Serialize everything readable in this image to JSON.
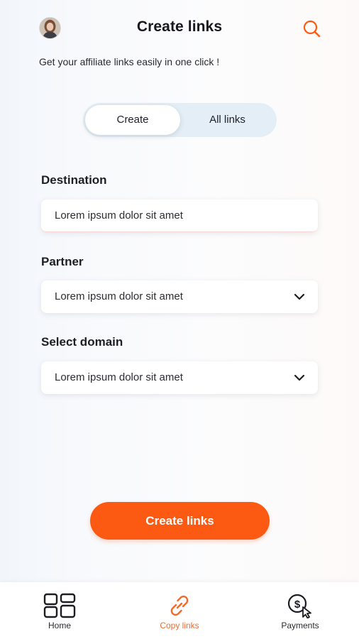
{
  "header": {
    "title": "Create links",
    "subtitle": "Get your affiliate links easily in one click !"
  },
  "tabs": [
    {
      "label": "Create",
      "active": true
    },
    {
      "label": "All links",
      "active": false
    }
  ],
  "form": {
    "destination": {
      "label": "Destination",
      "value": "Lorem ipsum dolor sit amet"
    },
    "partner": {
      "label": "Partner",
      "value": "Lorem ipsum dolor sit amet"
    },
    "domain": {
      "label": "Select domain",
      "value": "Lorem ipsum dolor sit amet"
    }
  },
  "cta": {
    "label": "Create links"
  },
  "bottom_nav": [
    {
      "label": "Home",
      "icon": "grid-icon",
      "active": false
    },
    {
      "label": "Copy links",
      "icon": "link-icon",
      "active": true
    },
    {
      "label": "Payments",
      "icon": "dollar-cursor-icon",
      "active": false
    }
  ],
  "colors": {
    "accent": "#fc5a12",
    "tab_bg": "#e3eef7",
    "text": "#1c1c22"
  }
}
